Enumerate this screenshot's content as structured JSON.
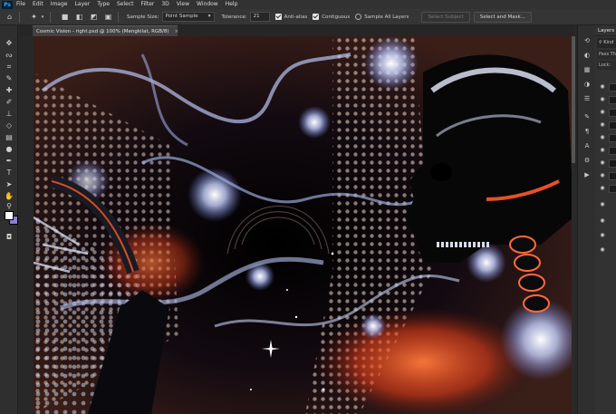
{
  "app": {
    "logo_text": "Ps",
    "menu": [
      "File",
      "Edit",
      "Image",
      "Layer",
      "Type",
      "Select",
      "Filter",
      "3D",
      "View",
      "Window",
      "Help"
    ]
  },
  "options_bar": {
    "sample_size_label": "Sample Size:",
    "sample_size_value": "Point Sample",
    "tolerance_label": "Tolerance:",
    "tolerance_value": "21",
    "anti_alias_label": "Anti-alias",
    "contiguous_label": "Contiguous",
    "sample_all_layers_label": "Sample All Layers",
    "select_subject_label": "Select Subject",
    "select_and_mask_label": "Select and Mask..."
  },
  "document": {
    "tab_title": "Cosmic Vision - right.psd @ 100% (Mengkilat, RGB/8)",
    "close_glyph": "×"
  },
  "colors": {
    "foreground": "#ffffff",
    "background": "#8a7fd0",
    "accent_orange": "#ff4a1c",
    "accent_blue": "#9fb2ff"
  },
  "layers_panel": {
    "title": "Layers",
    "search_text": "Kind",
    "blend_mode": "Pass Th",
    "lock_label": "Lock:"
  }
}
